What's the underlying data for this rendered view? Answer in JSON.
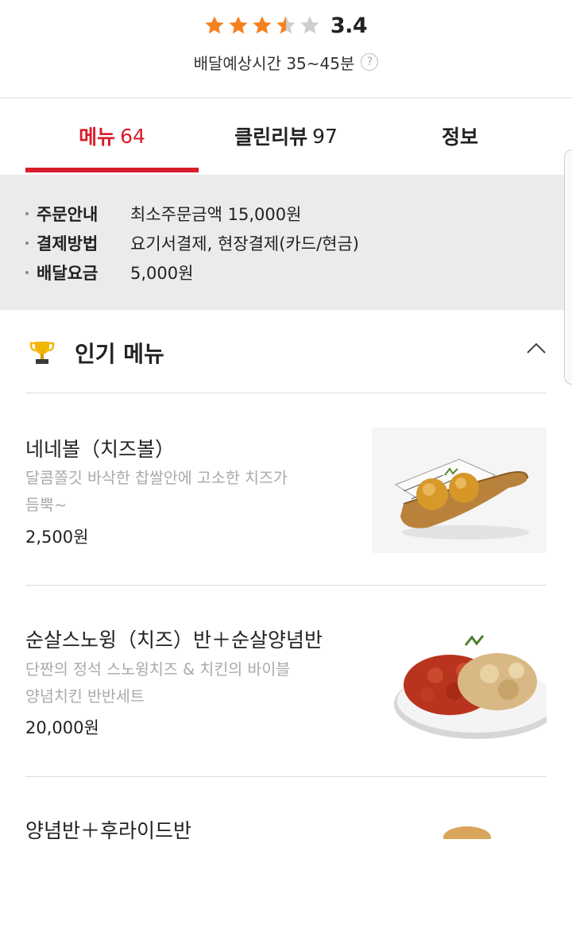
{
  "header": {
    "rating": 3.4,
    "rating_text": "3.4",
    "delivery_time": "배달예상시간 35~45분",
    "help_icon_text": "?",
    "star_color": "#f5821f"
  },
  "tabs": [
    {
      "label": "메뉴",
      "count": "64",
      "active": true
    },
    {
      "label": "클린리뷰",
      "count": "97",
      "active": false
    },
    {
      "label": "정보",
      "count": "",
      "active": false
    }
  ],
  "accent_color": "#d81d2c",
  "order_info": [
    {
      "label": "주문안내",
      "value": "최소주문금액 15,000원"
    },
    {
      "label": "결제방법",
      "value": "요기서결제, 현장결제(카드/현금)"
    },
    {
      "label": "배달요금",
      "value": "5,000원"
    }
  ],
  "popular": {
    "title": "인기 메뉴",
    "icon": "trophy-icon",
    "items": [
      {
        "name": "네네볼（치즈볼）",
        "desc_line1": "달콤쫄깃 바삭한 찹쌀안에 고소한 치즈가",
        "desc_line2": "듬뿍~",
        "price": "2,500원"
      },
      {
        "name": "순살스노윙（치즈）반＋순살양념반",
        "desc_line1": "단짠의 정석 스노윙치즈 & 치킨의 바이블",
        "desc_line2": "양념치킨 반반세트",
        "price": "20,000원"
      },
      {
        "name": "양념반＋후라이드반",
        "desc_line1": "",
        "desc_line2": "",
        "price": ""
      }
    ]
  }
}
